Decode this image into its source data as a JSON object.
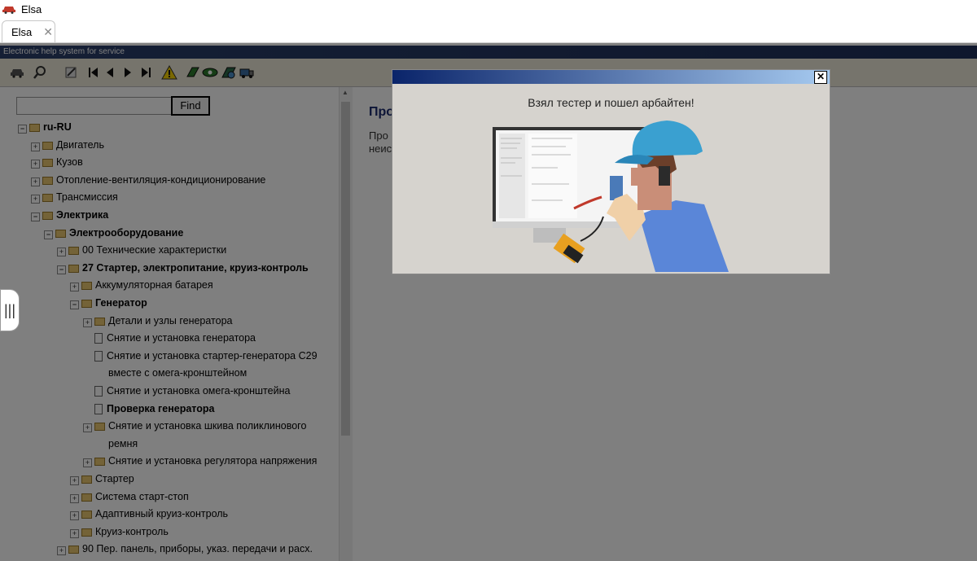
{
  "window": {
    "title": "Elsa",
    "tab_label": "Elsa",
    "tab_close": "✕"
  },
  "header": {
    "text": "Electronic help system for service"
  },
  "toolbar": {
    "icons": [
      "car-icon",
      "search-icon",
      "edit-icon",
      "first-icon",
      "prev-icon",
      "next-icon",
      "last-icon",
      "warning-icon",
      "book-icon",
      "eye-icon",
      "globe-icon",
      "truck-icon"
    ]
  },
  "search": {
    "value": "",
    "find_label": "Find"
  },
  "tree": {
    "items": [
      {
        "label": "ru-RU",
        "bold": true,
        "exp": "−"
      },
      {
        "label": "Двигатель",
        "exp": "+"
      },
      {
        "label": "Кузов",
        "exp": "+"
      },
      {
        "label": "Отопление-вентиляция-кондиционирование",
        "exp": "+"
      },
      {
        "label": "Трансмиссия",
        "exp": "+"
      },
      {
        "label": "Электрика",
        "bold": true,
        "exp": "−"
      },
      {
        "label": "Электрооборудование",
        "bold": true,
        "exp": "−"
      },
      {
        "label": "00 Технические характеристки",
        "exp": "+"
      },
      {
        "label": "27 Стартер, электропитание, круиз-контроль",
        "bold": true,
        "exp": "−"
      },
      {
        "label": "Аккумуляторная батарея",
        "exp": "+"
      },
      {
        "label": "Генератор",
        "bold": true,
        "exp": "−"
      },
      {
        "label": "Детали и узлы генератора",
        "exp": "+"
      },
      {
        "label": "Снятие и установка генератора"
      },
      {
        "label": "Снятие и установка стартер-генератора C29"
      },
      {
        "label": "вместе с омега-кронштейном"
      },
      {
        "label": "Снятие и установка омега-кронштейна"
      },
      {
        "label": "Проверка генератора",
        "bold": true
      },
      {
        "label": "Снятие и установка шкива поликлинового",
        "exp": "+"
      },
      {
        "label": "ремня"
      },
      {
        "label": "Снятие и установка регулятора напряжения",
        "exp": "+"
      },
      {
        "label": "Стартер",
        "exp": "+"
      },
      {
        "label": "Система старт-стоп",
        "exp": "+"
      },
      {
        "label": "Адаптивный круиз-контроль",
        "exp": "+"
      },
      {
        "label": "Круиз-контроль",
        "exp": "+"
      },
      {
        "label": "90 Пер. панель, приборы, указ. передачи и расх.",
        "exp": "+"
      }
    ]
  },
  "content": {
    "title": "Про",
    "text_line1": "Про",
    "text_line2": "неис"
  },
  "dialog": {
    "message": "Взял тестер и пошел арбайтен!",
    "close": "✕"
  }
}
